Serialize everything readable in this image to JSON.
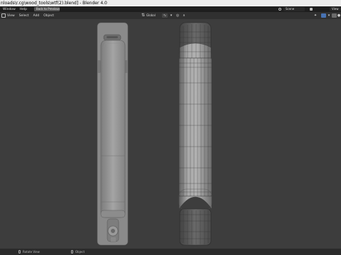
{
  "window": {
    "title": "nloads\\r.cg\\wood_tools\\wtf(2).blend] - Blender 4.0"
  },
  "topbar": {
    "menus": [
      "Window",
      "Help"
    ],
    "back_button": "Back to Previous",
    "scene": "Scene",
    "view_layer": "View"
  },
  "header": {
    "menus": [
      "View",
      "Select",
      "Add",
      "Object"
    ],
    "orientation": "Global"
  },
  "status": {
    "left": "Rotate View",
    "right": "Object"
  },
  "colors": {
    "viewport_bg": "#3d3d3d",
    "mesh": "#9c9c9c",
    "accent": "#4772b3"
  }
}
